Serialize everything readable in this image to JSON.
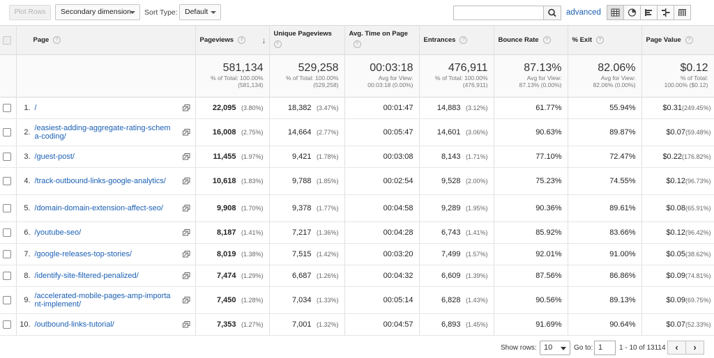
{
  "toolbar": {
    "plot_rows": "Plot Rows",
    "secondary_dimension": "Secondary dimension",
    "sort_type_label": "Sort Type:",
    "sort_type_value": "Default",
    "search_placeholder": "",
    "advanced": "advanced",
    "view_icons": [
      "table-view-icon",
      "pie-view-icon",
      "performance-view-icon",
      "comparison-view-icon",
      "pivot-view-icon"
    ]
  },
  "headers": {
    "page": "Page",
    "pageviews": "Pageviews",
    "unique_pageviews": "Unique Pageviews",
    "avg_time": "Avg. Time on Page",
    "entrances": "Entrances",
    "bounce_rate": "Bounce Rate",
    "exit": "% Exit",
    "page_value": "Page Value"
  },
  "totals": {
    "pageviews": {
      "value": "581,134",
      "line1": "% of Total: 100.00%",
      "line2": "(581,134)"
    },
    "unique_pageviews": {
      "value": "529,258",
      "line1": "% of Total: 100.00%",
      "line2": "(529,258)"
    },
    "avg_time": {
      "value": "00:03:18",
      "line1": "Avg for View:",
      "line2": "00:03:18 (0.00%)"
    },
    "entrances": {
      "value": "476,911",
      "line1": "% of Total: 100.00%",
      "line2": "(476,911)"
    },
    "bounce_rate": {
      "value": "87.13%",
      "line1": "Avg for View:",
      "line2": "87.13% (0.00%)"
    },
    "exit": {
      "value": "82.06%",
      "line1": "Avg for View:",
      "line2": "82.06% (0.00%)"
    },
    "page_value": {
      "value": "$0.12",
      "line1": "% of Total:",
      "line2": "100.00% ($0.12)"
    }
  },
  "rows": [
    {
      "idx": "1.",
      "page": "/",
      "pv": "22,095",
      "pv_pct": "(3.80%)",
      "upv": "18,382",
      "upv_pct": "(3.47%)",
      "time": "00:01:47",
      "ent": "14,883",
      "ent_pct": "(3.12%)",
      "bounce": "61.77%",
      "exit": "55.94%",
      "val": "$0.31",
      "val_pct": "(249.45%)"
    },
    {
      "idx": "2.",
      "page": "/easiest-adding-aggregate-rating-schema-coding/",
      "pv": "16,008",
      "pv_pct": "(2.75%)",
      "upv": "14,664",
      "upv_pct": "(2.77%)",
      "time": "00:05:47",
      "ent": "14,601",
      "ent_pct": "(3.06%)",
      "bounce": "90.63%",
      "exit": "89.87%",
      "val": "$0.07",
      "val_pct": "(59.48%)"
    },
    {
      "idx": "3.",
      "page": "/guest-post/",
      "pv": "11,455",
      "pv_pct": "(1.97%)",
      "upv": "9,421",
      "upv_pct": "(1.78%)",
      "time": "00:03:08",
      "ent": "8,143",
      "ent_pct": "(1.71%)",
      "bounce": "77.10%",
      "exit": "72.47%",
      "val": "$0.22",
      "val_pct": "(176.82%)"
    },
    {
      "idx": "4.",
      "page": "/track-outbound-links-google-analytics/",
      "pv": "10,618",
      "pv_pct": "(1.83%)",
      "upv": "9,788",
      "upv_pct": "(1.85%)",
      "time": "00:02:54",
      "ent": "9,528",
      "ent_pct": "(2.00%)",
      "bounce": "75.23%",
      "exit": "74.55%",
      "val": "$0.12",
      "val_pct": "(96.73%)"
    },
    {
      "idx": "5.",
      "page": "/domain-domain-extension-affect-seo/",
      "pv": "9,908",
      "pv_pct": "(1.70%)",
      "upv": "9,378",
      "upv_pct": "(1.77%)",
      "time": "00:04:58",
      "ent": "9,289",
      "ent_pct": "(1.95%)",
      "bounce": "90.36%",
      "exit": "89.61%",
      "val": "$0.08",
      "val_pct": "(65.91%)"
    },
    {
      "idx": "6.",
      "page": "/youtube-seo/",
      "pv": "8,187",
      "pv_pct": "(1.41%)",
      "upv": "7,217",
      "upv_pct": "(1.36%)",
      "time": "00:04:28",
      "ent": "6,743",
      "ent_pct": "(1.41%)",
      "bounce": "85.92%",
      "exit": "83.66%",
      "val": "$0.12",
      "val_pct": "(96.42%)"
    },
    {
      "idx": "7.",
      "page": "/google-releases-top-stories/",
      "pv": "8,019",
      "pv_pct": "(1.38%)",
      "upv": "7,515",
      "upv_pct": "(1.42%)",
      "time": "00:03:20",
      "ent": "7,499",
      "ent_pct": "(1.57%)",
      "bounce": "92.01%",
      "exit": "91.00%",
      "val": "$0.05",
      "val_pct": "(38.62%)"
    },
    {
      "idx": "8.",
      "page": "/identify-site-filtered-penalized/",
      "pv": "7,474",
      "pv_pct": "(1.29%)",
      "upv": "6,687",
      "upv_pct": "(1.26%)",
      "time": "00:04:32",
      "ent": "6,609",
      "ent_pct": "(1.39%)",
      "bounce": "87.56%",
      "exit": "86.86%",
      "val": "$0.09",
      "val_pct": "(74.81%)"
    },
    {
      "idx": "9.",
      "page": "/accelerated-mobile-pages-amp-important-implement/",
      "pv": "7,450",
      "pv_pct": "(1.28%)",
      "upv": "7,034",
      "upv_pct": "(1.33%)",
      "time": "00:05:14",
      "ent": "6,828",
      "ent_pct": "(1.43%)",
      "bounce": "90.56%",
      "exit": "89.13%",
      "val": "$0.09",
      "val_pct": "(69.75%)"
    },
    {
      "idx": "10.",
      "page": "/outbound-links-tutorial/",
      "pv": "7,353",
      "pv_pct": "(1.27%)",
      "upv": "7,001",
      "upv_pct": "(1.32%)",
      "time": "00:04:57",
      "ent": "6,893",
      "ent_pct": "(1.45%)",
      "bounce": "91.69%",
      "exit": "90.64%",
      "val": "$0.07",
      "val_pct": "(52.33%)"
    }
  ],
  "footer": {
    "show_rows_label": "Show rows:",
    "show_rows_value": "10",
    "goto_label": "Go to:",
    "goto_value": "1",
    "range": "1 - 10 of 13114",
    "prev": "‹",
    "next": "›"
  }
}
